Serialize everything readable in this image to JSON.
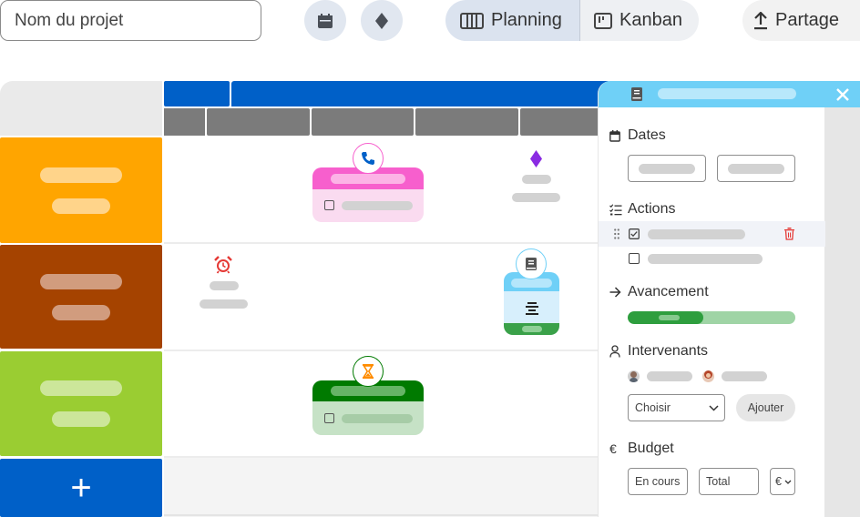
{
  "toolbar": {
    "project_placeholder": "Nom du projet",
    "calendar_icon": "calendar-icon",
    "diamond_icon": "diamond-icon",
    "view_planning_label": "Planning",
    "view_kanban_label": "Kanban",
    "share_label": "Partage",
    "active_view": "Planning"
  },
  "colors": {
    "blue": "#0060c8",
    "row1": "#ffa500",
    "row2": "#a54300",
    "row3": "#9acd32",
    "pink": "#f75fcd",
    "green": "#007a00",
    "light_blue": "#6fd0f7",
    "progress": "#2e9e3e"
  },
  "rows": [
    {
      "color": "#ffa500",
      "name": "row-orange"
    },
    {
      "color": "#a54300",
      "name": "row-brown"
    },
    {
      "color": "#9acd32",
      "name": "row-lime"
    }
  ],
  "add_row_label": "+",
  "panel": {
    "dates_label": "Dates",
    "actions_label": "Actions",
    "progress_label": "Avancement",
    "progress_fraction": 0.45,
    "contributors_label": "Intervenants",
    "choose_label": "Choisir",
    "add_label": "Ajouter",
    "budget_label": "Budget",
    "budget_current_placeholder": "En cours",
    "budget_total_placeholder": "Total",
    "currency": "€",
    "budget_icon": "€"
  }
}
